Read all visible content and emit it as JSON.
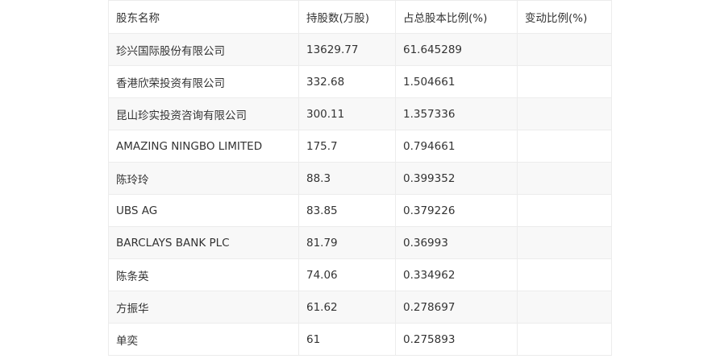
{
  "table": {
    "headers": [
      "股东名称",
      "持股数(万股)",
      "占总股本比例(%)",
      "变动比例(%)"
    ],
    "rows": [
      [
        "珍兴国际股份有限公司",
        "13629.77",
        "61.645289",
        ""
      ],
      [
        "香港欣荣投资有限公司",
        "332.68",
        "1.504661",
        ""
      ],
      [
        "昆山珍实投资咨询有限公司",
        "300.11",
        "1.357336",
        ""
      ],
      [
        "AMAZING NINGBO LIMITED",
        "175.7",
        "0.794661",
        ""
      ],
      [
        "陈玲玲",
        "88.3",
        "0.399352",
        ""
      ],
      [
        "UBS AG",
        "83.85",
        "0.379226",
        ""
      ],
      [
        "BARCLAYS BANK PLC",
        "81.79",
        "0.36993",
        ""
      ],
      [
        "陈条英",
        "74.06",
        "0.334962",
        ""
      ],
      [
        "方振华",
        "61.62",
        "0.278697",
        ""
      ],
      [
        "单奕",
        "61",
        "0.275893",
        ""
      ]
    ]
  }
}
